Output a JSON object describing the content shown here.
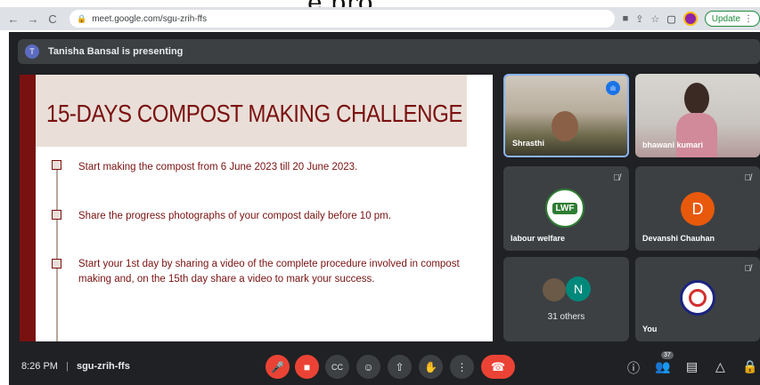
{
  "top_crop_text": "e pro",
  "browser": {
    "url": "meet.google.com/sgu-zrih-ffs",
    "update_label": "Update"
  },
  "banner": {
    "avatar_letter": "T",
    "text": "Tanisha Bansal is presenting"
  },
  "slide": {
    "title": "15-DAYS COMPOST MAKING CHALLENGE",
    "bullets": [
      "Start making the compost from 6 June 2023 till 20 June 2023.",
      "Share the progress photographs of your compost daily before 10 pm.",
      "Start your 1st day by sharing a video of the complete procedure involved in compost making and, on the 15th day share a video to mark your success."
    ]
  },
  "participants": {
    "shrasthi": "Shrasthi",
    "bhawani": "bhawani kumari",
    "labour": "labour welfare",
    "labour_logo": "LWF",
    "devanshi": "Devanshi Chauhan",
    "devanshi_letter": "D",
    "others": "31 others",
    "others_letter": "N",
    "you": "You"
  },
  "bottom": {
    "time": "8:26 PM",
    "separator": "|",
    "meeting_code": "sgu-zrih-ffs",
    "people_count": "37"
  },
  "colors": {
    "accent_red": "#ea4335",
    "slide_red": "#7a1111",
    "slide_beige": "#e9dfd8",
    "meet_bg": "#202124",
    "tile_bg": "#3c4043"
  }
}
